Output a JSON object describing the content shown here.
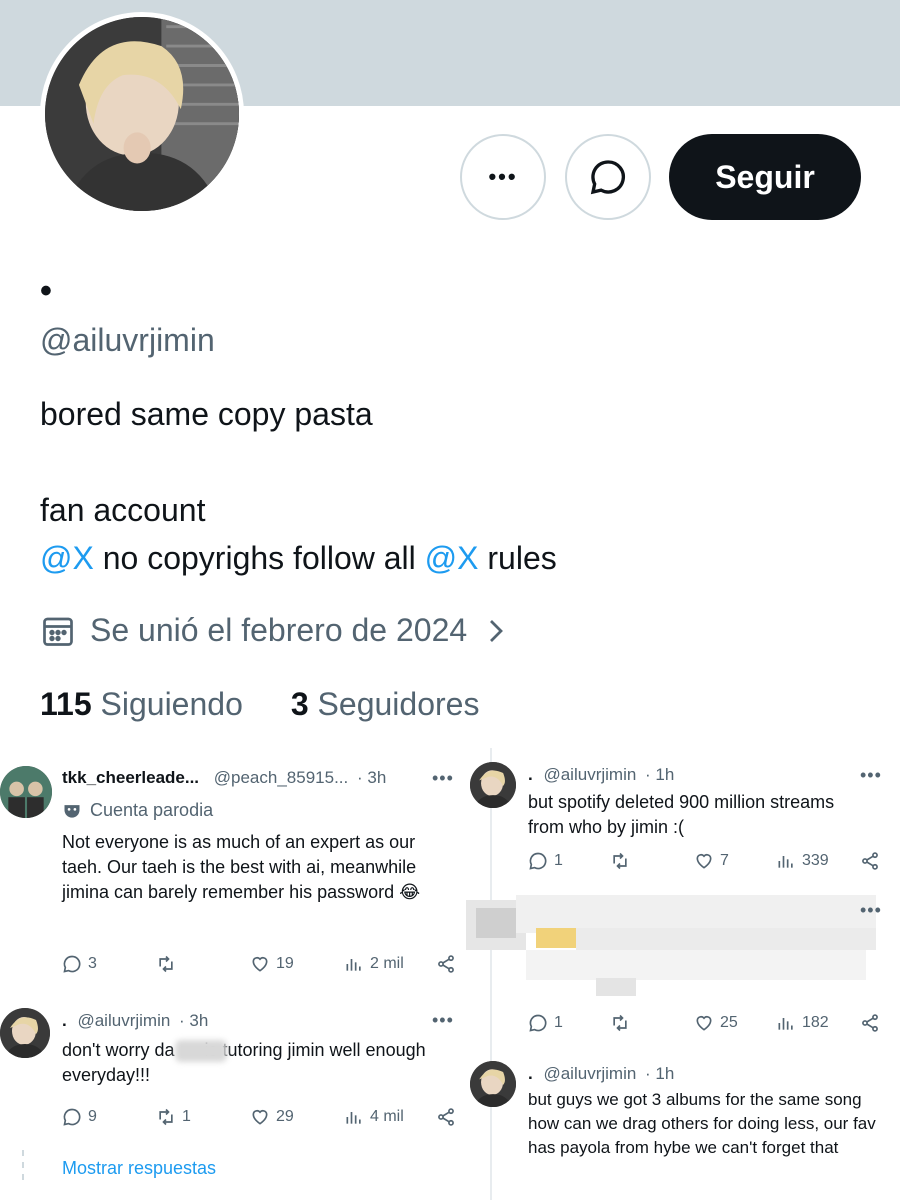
{
  "profile": {
    "display_name": "•",
    "handle": "@ailuvrjimin",
    "bio_line1": "bored same copy pasta",
    "bio_line2": "fan account",
    "bio_line3": {
      "mention1": "@X",
      "middle": " no copyrighs follow all ",
      "mention2": "@X",
      "end": " rules"
    },
    "joined": "Se unió el febrero de 2024",
    "following_count": "115",
    "following_label": "Siguiendo",
    "followers_count": "3",
    "followers_label": "Seguidores",
    "follow_button": "Seguir",
    "more_button": "•••"
  },
  "colors": {
    "accent": "#1d9bf0",
    "banner": "#cfd9de",
    "secondary_text": "#536471",
    "button_dark": "#0f1419"
  },
  "left_tweets": [
    {
      "name": "tkk_cheerleade...",
      "handle": "@peach_85915...",
      "time": "· 3h",
      "badge": "Cuenta parodia",
      "text": "Not everyone is as much of an expert as our taeh. Our taeh is the best with ai, meanwhile jimina can barely remember his password 😂",
      "replies": "3",
      "retweets": "",
      "likes": "19",
      "views": "2 mil"
    },
    {
      "name": ".",
      "handle": "@ailuvrjimin",
      "time": "· 3h",
      "text": "don't worry da      is tutoring jimin well enough everyday!!!",
      "replies": "9",
      "retweets": "1",
      "likes": "29",
      "views": "4 mil"
    }
  ],
  "show_replies": "Mostrar respuestas",
  "right_tweets": [
    {
      "name": ".",
      "handle": "@ailuvrjimin",
      "time": "· 1h",
      "text": "but spotify deleted 900 million streams from who by jimin :(",
      "replies": "1",
      "retweets": "",
      "likes": "7",
      "views": "339"
    },
    {
      "replies": "1",
      "retweets": "",
      "likes": "25",
      "views": "182"
    },
    {
      "name": ".",
      "handle": "@ailuvrjimin",
      "time": "· 1h",
      "text": "but guys we got 3 albums for the same song how can we drag others for doing less, our fav has payola from hybe we can't forget that"
    }
  ],
  "icons": {
    "more": "more-dots-icon",
    "message": "message-icon",
    "calendar": "calendar-icon",
    "chevron": "chevron-right-icon",
    "reply": "reply-icon",
    "retweet": "retweet-icon",
    "like": "heart-icon",
    "views": "views-icon",
    "share": "share-icon",
    "parody": "parody-mask-icon"
  }
}
